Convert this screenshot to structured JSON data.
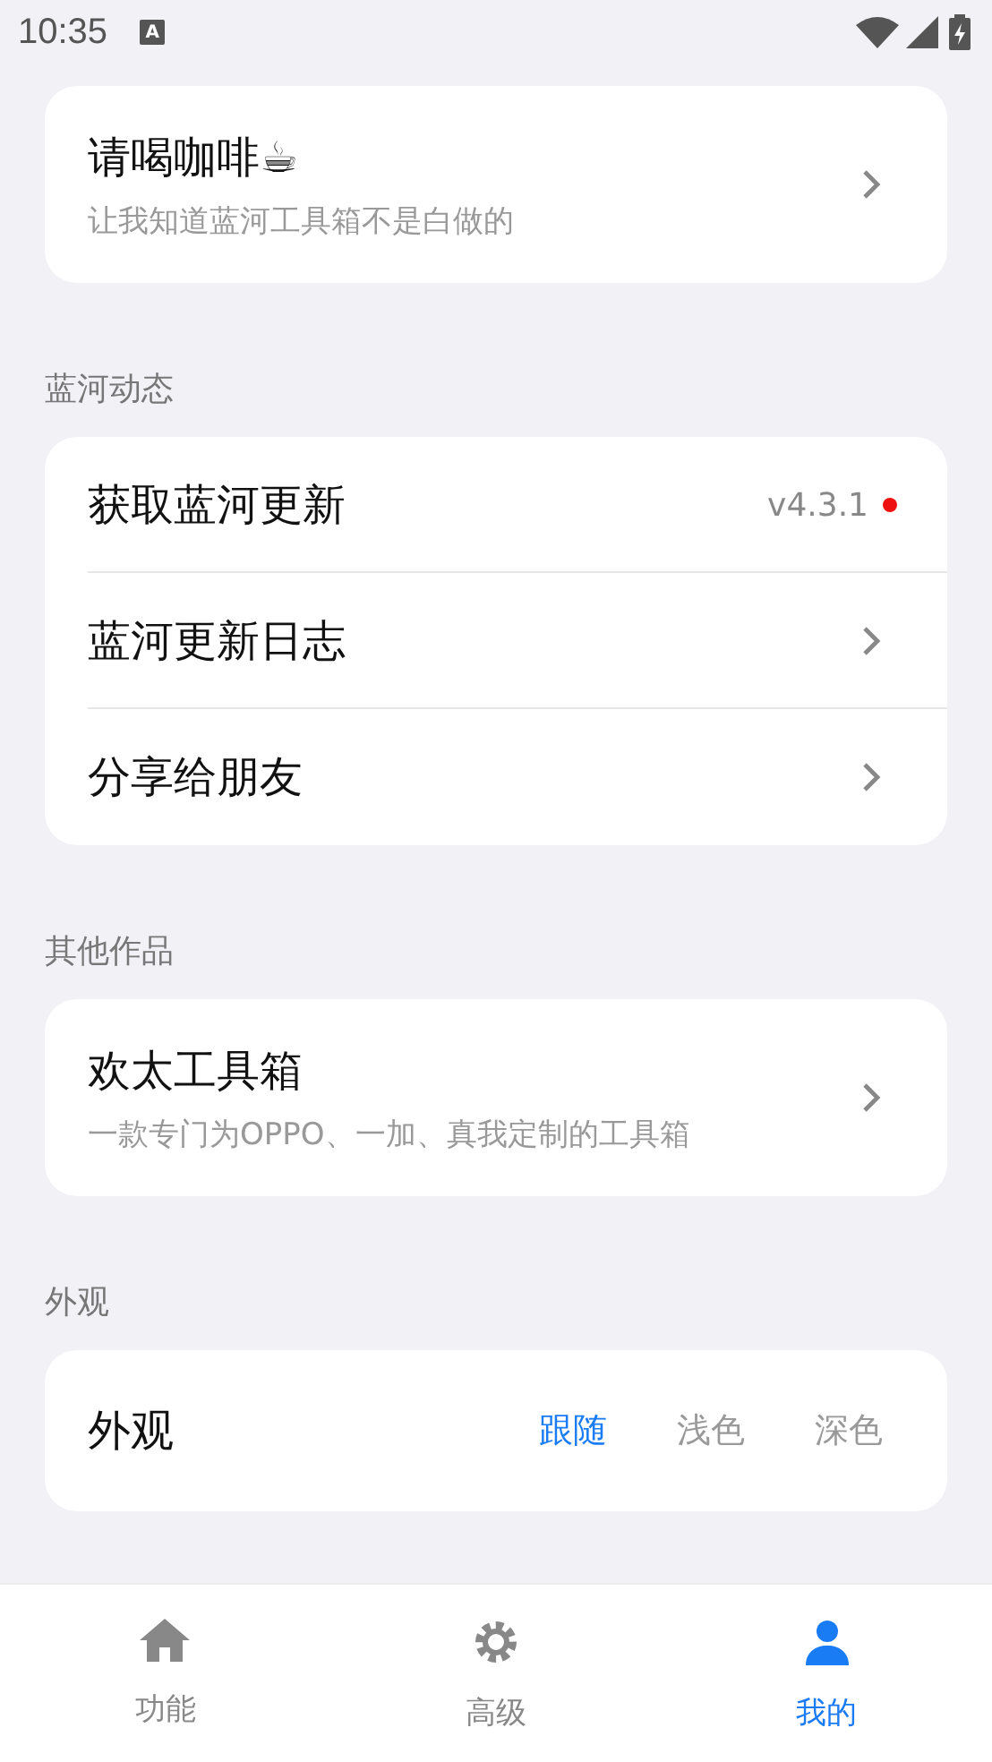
{
  "status_bar": {
    "time": "10:35",
    "notification": "A"
  },
  "sections": [
    {
      "rows": [
        {
          "kind": "link",
          "title": "请喝咖啡☕",
          "subtitle": "让我知道蓝河工具箱不是白做的"
        }
      ]
    },
    {
      "header": "蓝河动态",
      "rows": [
        {
          "kind": "update",
          "title": "获取蓝河更新",
          "value": "v4.3.1",
          "color": "#ee1111"
        },
        {
          "kind": "link",
          "title": "蓝河更新日志"
        },
        {
          "kind": "link",
          "title": "分享给朋友"
        }
      ]
    },
    {
      "header": "其他作品",
      "rows": [
        {
          "kind": "link",
          "title": "欢太工具箱",
          "subtitle": "一款专门为OPPO、一加、真我定制的工具箱"
        }
      ]
    },
    {
      "header": "外观",
      "rows": [
        {
          "kind": "choice",
          "title": "外观",
          "options": [
            {
              "label": "跟随",
              "selected": true
            },
            {
              "label": "浅色",
              "selected": false
            },
            {
              "label": "深色",
              "selected": false
            }
          ]
        }
      ]
    }
  ],
  "nav": [
    {
      "kind": "home",
      "label": "功能",
      "selected": false
    },
    {
      "kind": "gear",
      "label": "高级",
      "selected": false
    },
    {
      "kind": "person",
      "label": "我的",
      "selected": true
    }
  ]
}
